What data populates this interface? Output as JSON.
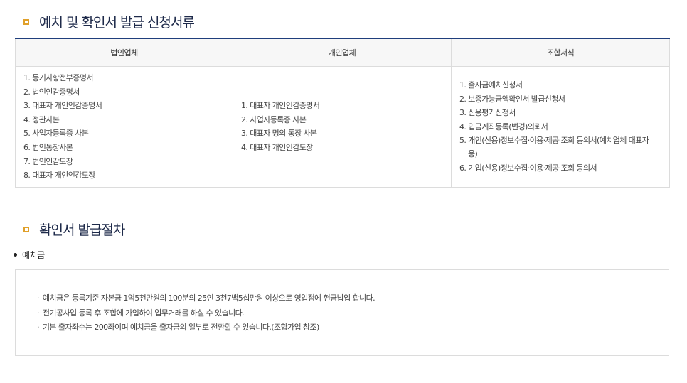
{
  "section1": {
    "title": "예치 및 확인서 발급 신청서류",
    "columns": [
      "법인업체",
      "개인업체",
      "조합서식"
    ],
    "corporate_items": [
      "1. 등기사항전부증명서",
      "2. 법인인감증명서",
      "3. 대표자 개인인감증명서",
      "4. 정관사본",
      "5. 사업자등록증 사본",
      "6. 법인통장사본",
      "7. 법인인감도장",
      "8. 대표자 개인인감도장"
    ],
    "individual_items": [
      "1. 대표자 개인인감증명서",
      "2. 사업자등록증 사본",
      "3. 대표자 명의 통장 사본",
      "4. 대표자 개인인감도장"
    ],
    "union_items": [
      "1. 출자금예치신청서",
      "2. 보증가능금액확인서 발급신청서",
      "3. 신용평가신청서",
      "4. 입금계좌등록(변경)의뢰서",
      "5. 개인(신용)정보수집·이용·제공·조회 동의서(예치업체 대표자",
      "용)",
      "6. 기업(신용)정보수집·이용·제공·조회 동의서"
    ]
  },
  "section2": {
    "title": "확인서 발급절차",
    "subheading": "예치금",
    "middot": "·",
    "items": [
      "예치금은 등록기준 자본금 1억5천만원의 100분의 25인 3천7백5십만원 이상으로 영업점에 현금납입 합니다.",
      "전기공사업 등록 후 조합에 가입하여 업무거래를 하실 수 있습니다.",
      "기본 출자좌수는 200좌이며 예치금을 출자금의 일부로 전환할 수 있습니다.(조합가입 참조)"
    ]
  }
}
